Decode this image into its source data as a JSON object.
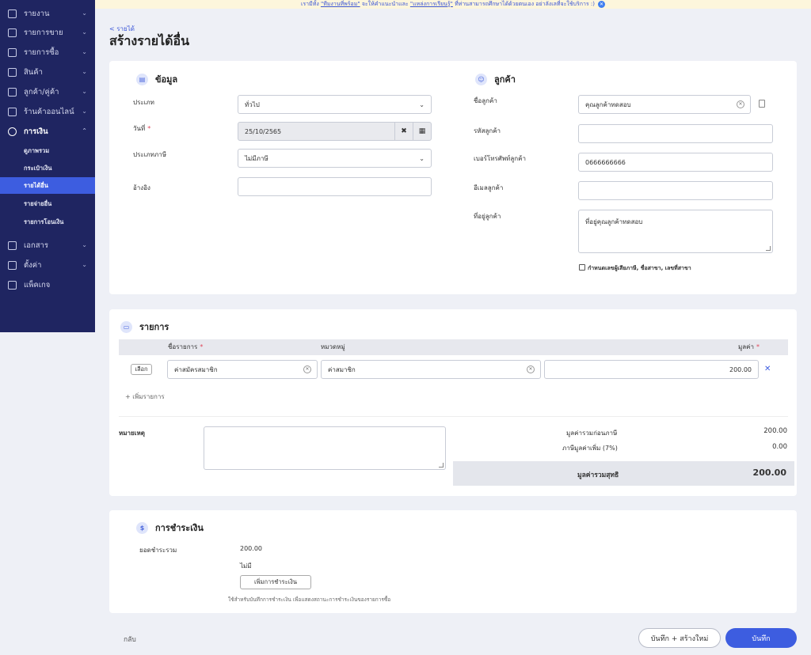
{
  "banner": {
    "pre": "เรามีทั้ง ",
    "link1": "\"ทีมงานที่พร้อม\"",
    "mid": " จะให้คำแนะนำและ ",
    "link2": "\"แหล่งการเรียนรู้\"",
    "post": " ที่ท่านสามารถศึกษาได้ด้วยตนเอง อย่าลังเลที่จะใช้บริการ :)"
  },
  "sidebar": {
    "items": [
      {
        "label": "รายงาน",
        "icon": "chart-icon"
      },
      {
        "label": "รายการขาย",
        "icon": "clipboard-icon"
      },
      {
        "label": "รายการซื้อ",
        "icon": "store-icon"
      },
      {
        "label": "สินค้า",
        "icon": "box-icon"
      },
      {
        "label": "ลูกค้า/คู่ค้า",
        "icon": "users-icon"
      },
      {
        "label": "ร้านค้าออนไลน์",
        "icon": "shop-icon"
      },
      {
        "label": "การเงิน",
        "icon": "dollar-icon"
      }
    ],
    "sub_items": [
      "ดูภาพรวม",
      "กระเป๋าเงิน",
      "รายได้อื่น",
      "รายจ่ายอื่น",
      "รายการโอนเงิน"
    ],
    "bottom_items": [
      {
        "label": "เอกสาร",
        "icon": "document-icon"
      },
      {
        "label": "ตั้งค่า",
        "icon": "gear-icon"
      },
      {
        "label": "แพ็คเกจ",
        "icon": "package-icon"
      }
    ]
  },
  "breadcrumb": "< รายได้",
  "page_title": "สร้างรายได้อื่น",
  "info": {
    "title": "ข้อมูล",
    "type_label": "ประเภท",
    "type_value": "ทั่วไป",
    "date_label": "วันที่",
    "date_value": "25/10/2565",
    "tax_label": "ประเภทภาษี",
    "tax_value": "ไม่มีภาษี",
    "ref_label": "อ้างอิง",
    "ref_value": ""
  },
  "customer": {
    "title": "ลูกค้า",
    "name_label": "ชื่อลูกค้า",
    "name_value": "คุณลูกค้าทดสอบ",
    "code_label": "รหัสลูกค้า",
    "code_value": "",
    "phone_label": "เบอร์โทรศัพท์ลูกค้า",
    "phone_value": "0666666666",
    "email_label": "อีเมลลูกค้า",
    "email_value": "",
    "address_label": "ที่อยู่ลูกค้า",
    "address_value": "ที่อยู่คุณลูกค้าทดสอบ",
    "tax_checkbox_label": "กำหนดเลขผู้เสียภาษี, ชื่อสาขา, เลขที่สาขา"
  },
  "items": {
    "title": "รายการ",
    "col_name": "ชื่อรายการ",
    "col_category": "หมวดหมู่",
    "col_value": "มูลค่า",
    "rows": [
      {
        "select_label": "เลือก",
        "name": "ค่าสมัครสมาชิก",
        "category": "ค่าสมาชิก",
        "value": "200.00"
      }
    ],
    "add_label": "+ เพิ่มรายการ"
  },
  "summary": {
    "note_label": "หมายเหตุ",
    "subtotal_label": "มูลค่ารวมก่อนภาษี",
    "subtotal_value": "200.00",
    "vat_label": "ภาษีมูลค่าเพิ่ม (7%)",
    "vat_value": "0.00",
    "total_label": "มูลค่ารวมสุทธิ",
    "total_value": "200.00"
  },
  "payment": {
    "title": "การชำระเงิน",
    "total_label": "ยอดชำระรวม",
    "total_value": "200.00",
    "status": "ไม่มี",
    "add_button": "เพิ่มการชำระเงิน",
    "hint": "ใช้สำหรับบันทึกการชำระเงิน เพื่อแสดงสถานะการชำระเงินของรายการซื้อ"
  },
  "footer": {
    "back": "กลับ",
    "save_new": "บันทึก + สร้างใหม่",
    "save": "บันทึก"
  },
  "colors": {
    "sidebar_bg": "#1f2561",
    "accent": "#3d5de0"
  }
}
